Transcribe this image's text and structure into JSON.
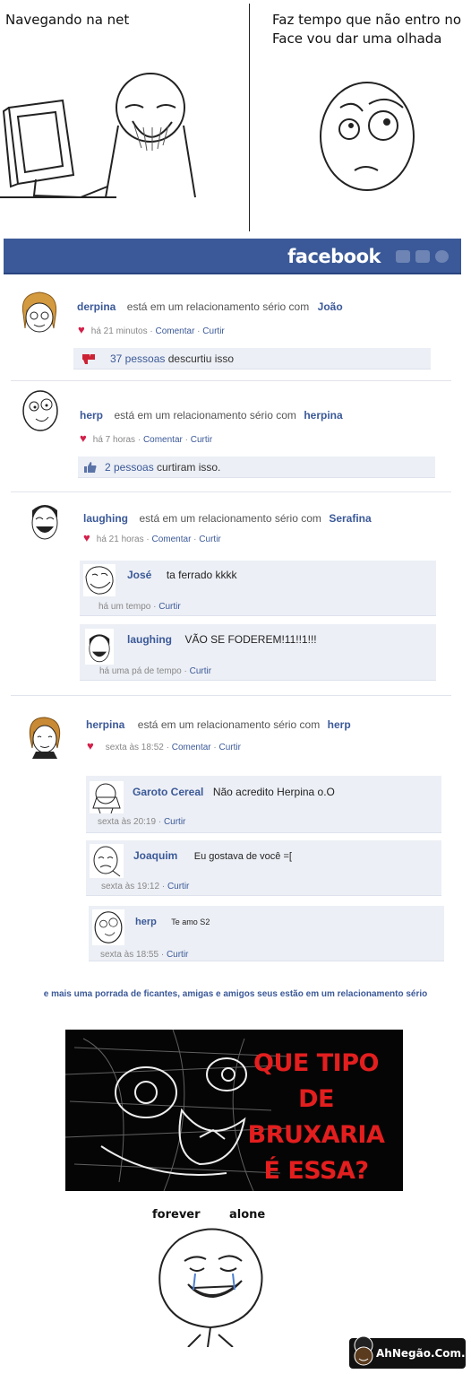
{
  "comic": {
    "panel1_caption": "Navegando na net",
    "panel2_caption": "Faz tempo que não entro no Face vou dar uma olhada"
  },
  "fb": {
    "logo": "facebook",
    "header_color": "#3b5998",
    "link_color": "#3b5998"
  },
  "posts": [
    {
      "name": "derpina",
      "status": "está em um relacionamento sério com",
      "partner": "João",
      "time": "há 21 minutos",
      "comment_label": "Comentar",
      "like_label": "Curtir",
      "reaction_count": "37 pessoas",
      "reaction_text": "descurtiu isso"
    },
    {
      "name": "herp",
      "status": "está em um relacionamento sério com",
      "partner": "herpina",
      "time": "há 7 horas",
      "comment_label": "Comentar",
      "like_label": "Curtir",
      "reaction_count": "2 pessoas",
      "reaction_text": "curtiram isso."
    },
    {
      "name": "laughing",
      "status": "está em um relacionamento sério com",
      "partner": "Serafina",
      "time": "há 21 horas",
      "comment_label": "Comentar",
      "like_label": "Curtir",
      "comments": [
        {
          "name": "José",
          "text": "ta  ferrado kkkk",
          "time": "há um tempo",
          "like": "Curtir"
        },
        {
          "name": "laughing",
          "text": "VÃO SE FODEREM!11!!1!!!",
          "time": "há uma pá de tempo",
          "like": "Curtir"
        }
      ]
    },
    {
      "name": "herpina",
      "status": "está em um relacionamento sério com",
      "partner": "herp",
      "time": "sexta às 18:52",
      "comment_label": "Comentar",
      "like_label": "Curtir",
      "comments": [
        {
          "name": "Garoto Cereal",
          "text": "Não acredito Herpina o.O",
          "time": "sexta às 20:19",
          "like": "Curtir"
        },
        {
          "name": "Joaquim",
          "text": "Eu gostava de você =[",
          "time": "sexta às 19:12",
          "like": "Curtir"
        },
        {
          "name": "herp",
          "text": "Te amo S2",
          "time": "sexta às 18:55",
          "like": "Curtir"
        }
      ]
    }
  ],
  "outro": "e mais uma porrada de ficantes, amigas e amigos seus estão em  um relacionamento sério",
  "meme": {
    "text_line1": "QUE TIPO DE",
    "text_line2": "BRUXARIA",
    "text_line3": "É ESSA?",
    "text_color": "#e31e1e"
  },
  "forever": {
    "word1": "forever",
    "word2": "alone"
  },
  "watermark": "AhNegão.Com.Br"
}
